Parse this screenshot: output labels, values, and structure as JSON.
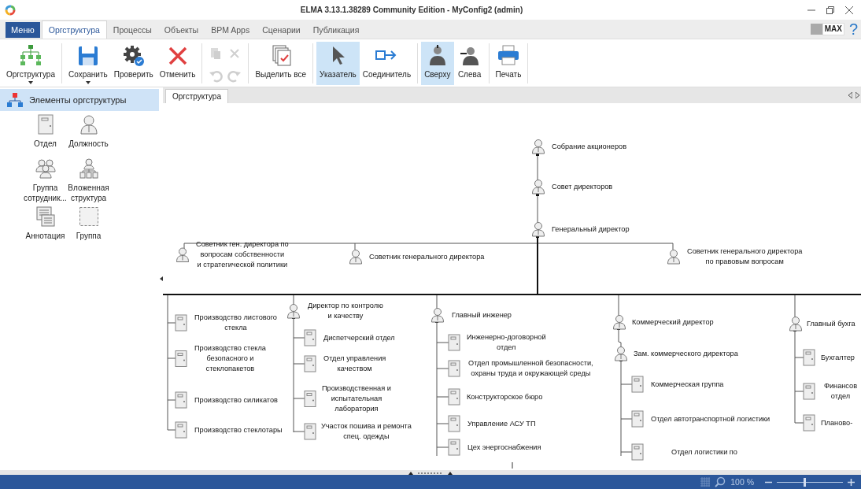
{
  "window": {
    "title": "ELMA 3.13.1.38289 Community Edition - MyConfig2 (admin)"
  },
  "menu_button": "Меню",
  "tabs": [
    {
      "label": "Оргструктура",
      "selected": true
    },
    {
      "label": "Процессы",
      "selected": false
    },
    {
      "label": "Объекты",
      "selected": false
    },
    {
      "label": "BPM Apps",
      "selected": false
    },
    {
      "label": "Сценарии",
      "selected": false
    },
    {
      "label": "Публикация",
      "selected": false
    }
  ],
  "edition_badge": "MAX",
  "help": "?",
  "ribbon": [
    {
      "kind": "big",
      "label": "Оргструктура",
      "dropdown": true,
      "selected": false
    },
    {
      "kind": "big",
      "label": "Сохранить",
      "dropdown": true,
      "selected": false
    },
    {
      "kind": "big",
      "label": "Проверить",
      "dropdown": false,
      "selected": false
    },
    {
      "kind": "big",
      "label": "Отменить",
      "dropdown": false,
      "selected": false
    },
    {
      "kind": "small",
      "disabled": true
    },
    {
      "kind": "big",
      "label": "Выделить все",
      "dropdown": false,
      "selected": false
    },
    {
      "kind": "big",
      "label": "Указатель",
      "dropdown": false,
      "selected": true
    },
    {
      "kind": "big",
      "label": "Соединитель",
      "dropdown": false,
      "selected": false
    },
    {
      "kind": "big",
      "label": "Сверху",
      "dropdown": false,
      "selected": true
    },
    {
      "kind": "big",
      "label": "Слева",
      "dropdown": false,
      "selected": false
    },
    {
      "kind": "big",
      "label": "Печать",
      "dropdown": false,
      "selected": false
    }
  ],
  "sidebar": {
    "title": "Элементы оргструктуры",
    "items": [
      {
        "label": "Отдел"
      },
      {
        "label": "Должность"
      },
      {
        "label": "Группа\nсотрудник..."
      },
      {
        "label": "Вложенная\nструктура"
      },
      {
        "label": "Аннотация"
      },
      {
        "label": "Группа"
      }
    ]
  },
  "document_tab": {
    "label": "Оргструктура",
    "selected": true
  },
  "diagram": {
    "root": {
      "kind": "position",
      "label": "Собрание акционеров",
      "children": [
        {
          "kind": "position",
          "label": "Совет директоров",
          "children": [
            {
              "kind": "position",
              "label": "Генеральный директор",
              "children": [
                {
                  "kind": "position",
                  "label": "Советник ген. директора по\nвопросам собственности\nи стратегической политики"
                },
                {
                  "kind": "position",
                  "label": "Советник генерального директора"
                },
                {
                  "kind": "position",
                  "label": "Советник генерального директора\nпо правовым вопросам"
                },
                {
                  "kind": "department",
                  "label": "Производство листового\nстекла"
                },
                {
                  "kind": "department",
                  "label": "Производство стекла\nбезопасного и\nстеклопакетов"
                },
                {
                  "kind": "department",
                  "label": "Производство силикатов"
                },
                {
                  "kind": "department",
                  "label": "Производство стеклотары"
                },
                {
                  "kind": "position",
                  "label": "Директор по контролю\nи качеству",
                  "children": [
                    {
                      "kind": "department",
                      "label": "Диспетчерский отдел"
                    },
                    {
                      "kind": "department",
                      "label": "Отдел управления\nкачеством"
                    },
                    {
                      "kind": "department",
                      "label": "Производственная и\nиспытательная\nлаборатория"
                    },
                    {
                      "kind": "department",
                      "label": "Участок пошива и ремонта\nспец. одежды"
                    }
                  ]
                },
                {
                  "kind": "position",
                  "label": "Главный инженер",
                  "children": [
                    {
                      "kind": "department",
                      "label": "Инженерно-договорной\nотдел"
                    },
                    {
                      "kind": "department",
                      "label": "Отдел промышленной безопасности,\nохраны труда и окружающей среды"
                    },
                    {
                      "kind": "department",
                      "label": "Конструкторское бюро"
                    },
                    {
                      "kind": "department",
                      "label": "Управление АСУ ТП"
                    },
                    {
                      "kind": "department",
                      "label": "Цех энергоснабжения"
                    }
                  ]
                },
                {
                  "kind": "position",
                  "label": "Коммерческий директор",
                  "children": [
                    {
                      "kind": "position",
                      "label": "Зам. коммерческого директора",
                      "children": [
                        {
                          "kind": "department",
                          "label": "Коммерческая группа"
                        },
                        {
                          "kind": "department",
                          "label": "Отдел автотранспортной логистики"
                        },
                        {
                          "kind": "department",
                          "label": "Отдел логистики по"
                        }
                      ]
                    }
                  ]
                },
                {
                  "kind": "position",
                  "label": "Главный бухга",
                  "children": [
                    {
                      "kind": "department",
                      "label": "Бухгалтер"
                    },
                    {
                      "kind": "department",
                      "label": "Финансов\nотдел"
                    },
                    {
                      "kind": "department",
                      "label": "Планово-"
                    }
                  ]
                }
              ]
            }
          ]
        }
      ]
    }
  },
  "status_bar": {
    "zoom": "100 %",
    "zoom_slider": {
      "level": 0.42
    }
  }
}
